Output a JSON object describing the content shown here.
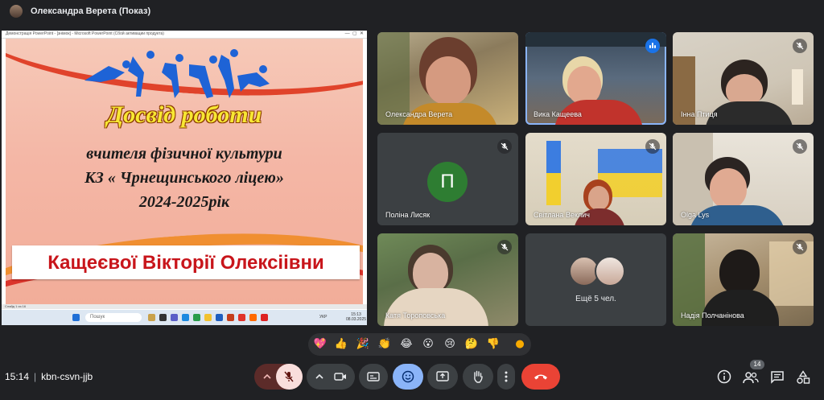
{
  "header": {
    "presenter_label": "Олександра Верета (Показ)"
  },
  "presentation": {
    "window_title": "Демонстрація PowerPoint - [знімок] - Microsoft PowerPoint (Сбой активации продукта)",
    "slide": {
      "heading": "Досвід роботи",
      "line1": "вчителя фізичної культури",
      "line2": "КЗ « Чрнещинського ліцею»",
      "line3": "2024-2025рік",
      "name": "Кащеєвої Вікторії Олексіівни"
    },
    "footer_text": "Слайд 1 из 16",
    "taskbar": {
      "search_placeholder": "Пошук",
      "lang": "УКР",
      "time": "15:13",
      "date": "08.03.2025"
    }
  },
  "participants": [
    {
      "name": "Олександра Верета",
      "muted": false
    },
    {
      "name": "Вика Кащеева",
      "muted": false,
      "speaking": true
    },
    {
      "name": "Інна Птиця",
      "muted": true
    },
    {
      "name": "Поліна Лисяк",
      "muted": true,
      "avatar_letter": "П",
      "avatar_color": "#2e7d32"
    },
    {
      "name": "Світлана Веклич",
      "muted": true
    },
    {
      "name": "Olga Lys",
      "muted": true
    },
    {
      "name": "Катя Тороповська",
      "muted": true
    },
    {
      "name": "Надія Полчанінова",
      "muted": true
    }
  ],
  "more_tile": {
    "label": "Ещё 5 чел."
  },
  "reactions": [
    "💖",
    "👍",
    "🎉",
    "👏",
    "😂",
    "😮",
    "😢",
    "🤔",
    "👎",
    "●"
  ],
  "meeting": {
    "time": "15:14",
    "code": "kbn-csvn-jjb",
    "participant_count": "14"
  },
  "controls": {
    "mic": "mic-off",
    "leave_color": "#ea4335",
    "mic_off_bg": "#f9dedc",
    "accent": "#8ab4f8"
  }
}
